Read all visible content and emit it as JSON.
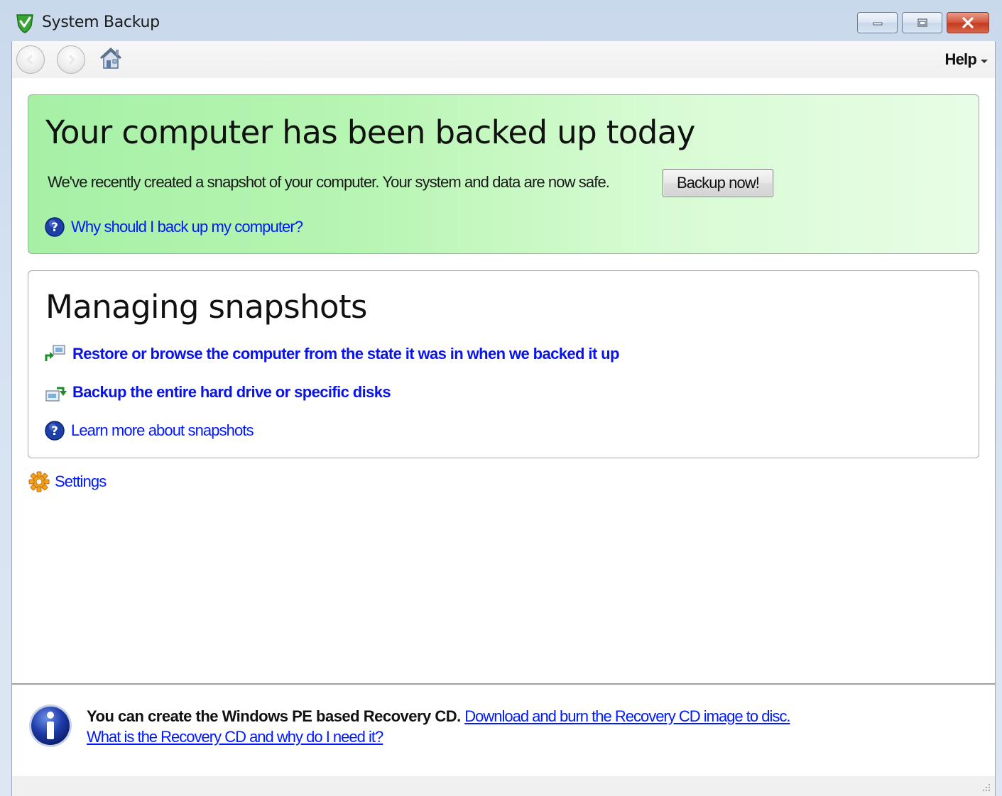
{
  "window": {
    "title": "System Backup",
    "app_icon": "green-shield-check-icon",
    "controls": [
      "minimize-icon",
      "maximize-icon",
      "close-icon"
    ]
  },
  "toolbar": {
    "back_icon": "back-arrow-icon",
    "forward_icon": "forward-arrow-icon",
    "home_icon": "home-icon",
    "help_label": "Help"
  },
  "status_panel": {
    "title": "Your computer has been backed up today",
    "description": "We've recently created a snapshot of your computer. Your system and data are now safe.",
    "backup_button": "Backup now!",
    "why_link": "Why should I back up my computer?",
    "background_color": "#b7f5b2"
  },
  "snapshots_panel": {
    "title": "Managing snapshots",
    "restore_link": "Restore or browse the computer from the state it was in when we backed it up",
    "backup_link": "Backup the entire hard drive or specific disks",
    "learn_link": "Learn more about snapshots"
  },
  "settings": {
    "label": "Settings",
    "icon": "gear-icon"
  },
  "footer": {
    "info_icon": "info-icon",
    "bold_text": "You can create the Windows PE based Recovery CD.",
    "download_link": "Download and burn the Recovery CD image to disc.",
    "what_link": "What is the Recovery CD and why do I need it?"
  },
  "colors": {
    "link": "#0019ff",
    "titlebar": "#c9d9ec",
    "close_button": "#c33b1f"
  }
}
